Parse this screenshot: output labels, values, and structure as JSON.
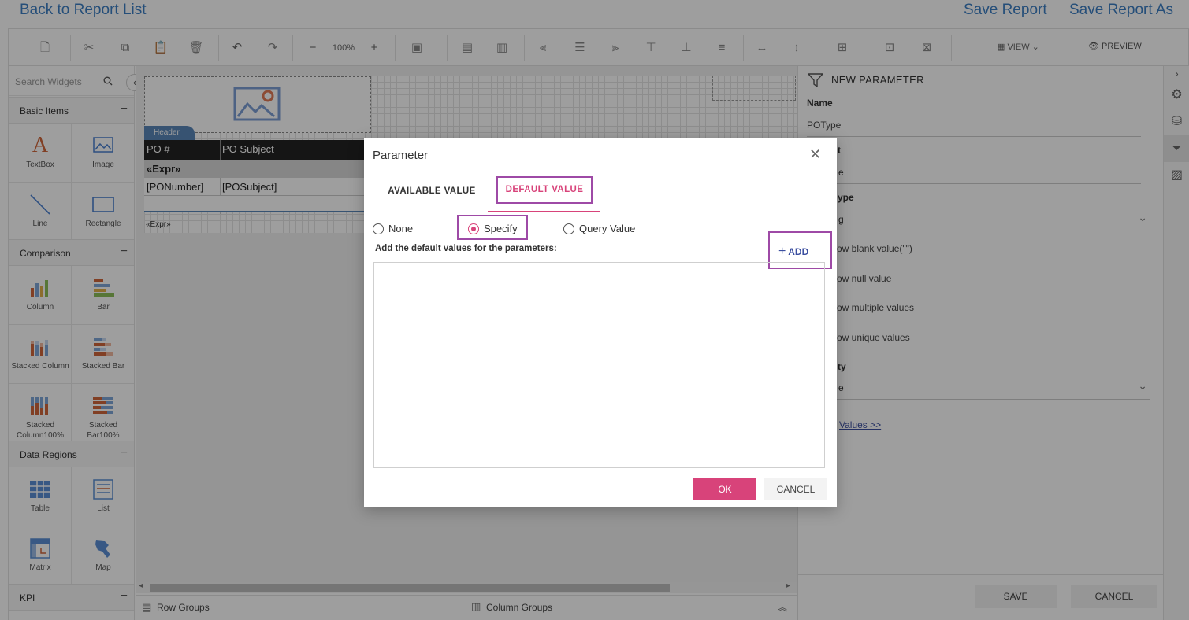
{
  "topbar": {
    "back_link": "Back to Report List",
    "save_report": "Save Report",
    "save_report_as": "Save Report As"
  },
  "toolbar": {
    "zoom": "100%",
    "view_label": "VIEW",
    "preview_label": "PREVIEW"
  },
  "widgets": {
    "search_placeholder": "Search Widgets",
    "sections": {
      "basic": "Basic Items",
      "comparison": "Comparison",
      "data_regions": "Data Regions",
      "kpi": "KPI"
    },
    "items": {
      "textbox": "TextBox",
      "image": "Image",
      "line": "Line",
      "rectangle": "Rectangle",
      "column": "Column",
      "bar": "Bar",
      "stacked_column": "Stacked Column",
      "stacked_bar": "Stacked Bar",
      "stacked_column100": "Stacked Column100%",
      "stacked_bar100": "Stacked Bar100%",
      "table": "Table",
      "list": "List",
      "matrix": "Matrix",
      "map": "Map"
    }
  },
  "design": {
    "header_tag": "Header",
    "col1_header": "PO #",
    "col2_header": "PO Subject",
    "group_expr": "«Expr»",
    "col1_value": "[PONumber]",
    "col2_value": "[POSubject]",
    "footer_expr": "«Expr»"
  },
  "bottom": {
    "row_groups": "Row Groups",
    "column_groups": "Column Groups"
  },
  "param_panel": {
    "title": "NEW PARAMETER",
    "name_label": "Name",
    "name_value": "POType",
    "prompt_label_partial": "t",
    "prompt_value_partial": "e",
    "type_label_partial": "ype",
    "type_value_partial": "g",
    "allow_blank_partial": "ow blank value(\"\")",
    "allow_null_partial": "ow null value",
    "allow_multiple_partial": "ow multiple values",
    "allow_unique_partial": "ow unique values",
    "visibility_label_partial": "ty",
    "visibility_value_partial": "e",
    "values_link_partial": "Values >>",
    "save_button": "SAVE",
    "cancel_button": "CANCEL"
  },
  "dialog": {
    "title": "Parameter",
    "tab_available": "AVAILABLE VALUE",
    "tab_default": "DEFAULT VALUE",
    "radio_none": "None",
    "radio_specify": "Specify",
    "radio_query": "Query Value",
    "instructions": "Add the default values for the parameters:",
    "add_label": "ADD",
    "ok_button": "OK",
    "cancel_button": "CANCEL",
    "selected_radio": "Specify"
  },
  "colors": {
    "accent_pink": "#d8437a",
    "highlight_purple": "#9e4aa6",
    "link_blue": "#3c7fc4"
  }
}
